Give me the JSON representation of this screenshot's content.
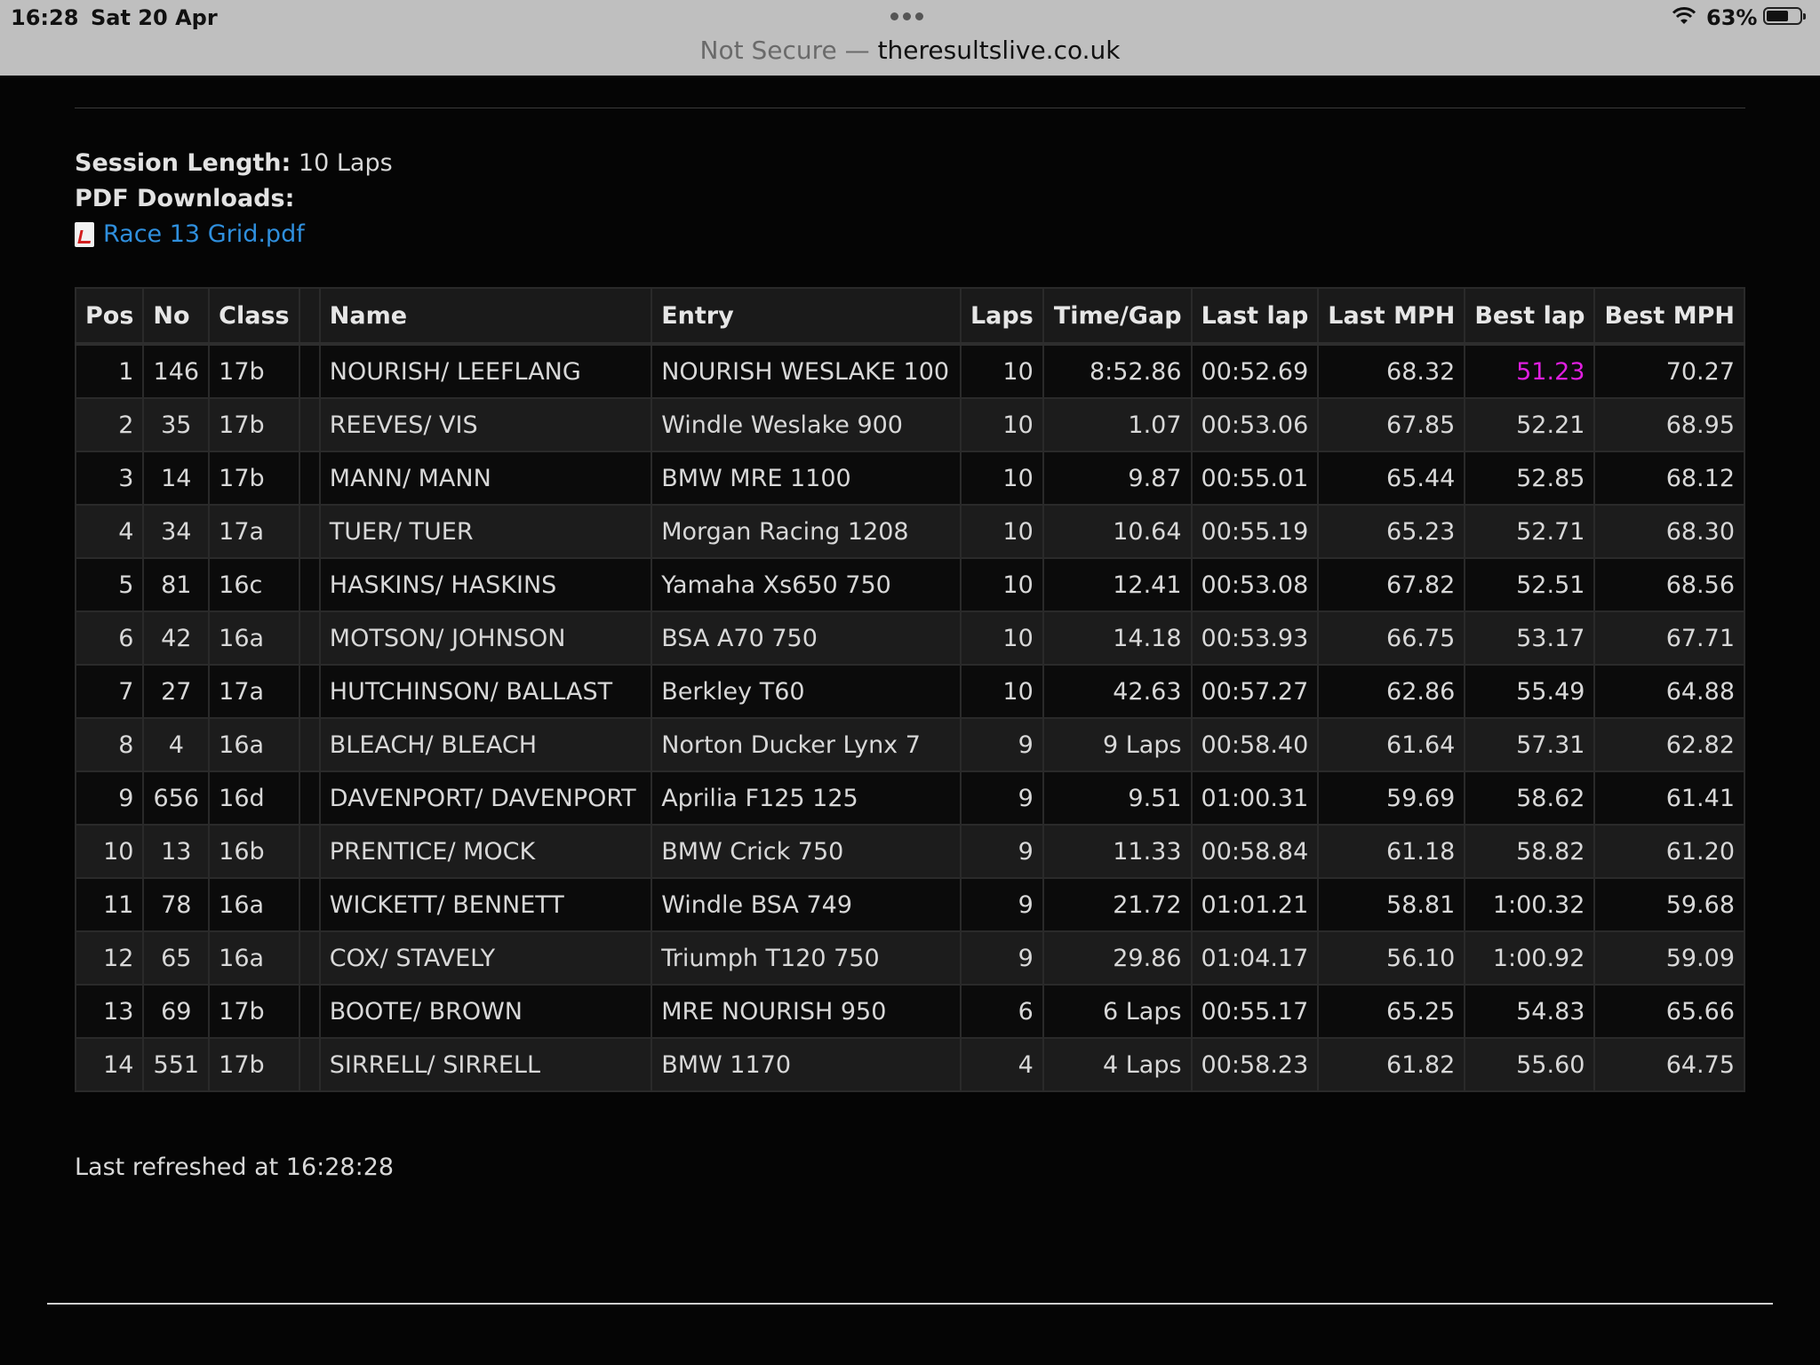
{
  "status_bar": {
    "time": "16:28",
    "date": "Sat 20 Apr",
    "battery": "63%"
  },
  "url_bar": {
    "security": "Not Secure —",
    "domain": "theresultslive.co.uk"
  },
  "session": {
    "length_label": "Session Length:",
    "length_value": "10 Laps",
    "pdf_label": "PDF Downloads:",
    "pdf_file": "Race 13 Grid.pdf"
  },
  "table": {
    "headers": [
      "Pos",
      "No",
      "Class",
      "",
      "Name",
      "Entry",
      "Laps",
      "Time/Gap",
      "Last lap",
      "Last MPH",
      "Best lap",
      "Best MPH"
    ],
    "rows": [
      [
        "1",
        "146",
        "17b",
        "NOURISH/ LEEFLANG",
        "NOURISH WESLAKE 100",
        "10",
        "8:52.86",
        "00:52.69",
        "68.32",
        "51.23",
        "70.27"
      ],
      [
        "2",
        "35",
        "17b",
        "REEVES/ VIS",
        "Windle Weslake 900",
        "10",
        "1.07",
        "00:53.06",
        "67.85",
        "52.21",
        "68.95"
      ],
      [
        "3",
        "14",
        "17b",
        "MANN/ MANN",
        "BMW MRE 1100",
        "10",
        "9.87",
        "00:55.01",
        "65.44",
        "52.85",
        "68.12"
      ],
      [
        "4",
        "34",
        "17a",
        "TUER/ TUER",
        "Morgan Racing 1208",
        "10",
        "10.64",
        "00:55.19",
        "65.23",
        "52.71",
        "68.30"
      ],
      [
        "5",
        "81",
        "16c",
        "HASKINS/ HASKINS",
        "Yamaha Xs650 750",
        "10",
        "12.41",
        "00:53.08",
        "67.82",
        "52.51",
        "68.56"
      ],
      [
        "6",
        "42",
        "16a",
        "MOTSON/ JOHNSON",
        "BSA A70 750",
        "10",
        "14.18",
        "00:53.93",
        "66.75",
        "53.17",
        "67.71"
      ],
      [
        "7",
        "27",
        "17a",
        "HUTCHINSON/ BALLAST",
        "Berkley T60",
        "10",
        "42.63",
        "00:57.27",
        "62.86",
        "55.49",
        "64.88"
      ],
      [
        "8",
        "4",
        "16a",
        "BLEACH/ BLEACH",
        "Norton Ducker Lynx 7",
        "9",
        "9 Laps",
        "00:58.40",
        "61.64",
        "57.31",
        "62.82"
      ],
      [
        "9",
        "656",
        "16d",
        "DAVENPORT/ DAVENPORT",
        "Aprilia F125 125",
        "9",
        "9.51",
        "01:00.31",
        "59.69",
        "58.62",
        "61.41"
      ],
      [
        "10",
        "13",
        "16b",
        "PRENTICE/ MOCK",
        "BMW Crick 750",
        "9",
        "11.33",
        "00:58.84",
        "61.18",
        "58.82",
        "61.20"
      ],
      [
        "11",
        "78",
        "16a",
        "WICKETT/ BENNETT",
        "Windle BSA 749",
        "9",
        "21.72",
        "01:01.21",
        "58.81",
        "1:00.32",
        "59.68"
      ],
      [
        "12",
        "65",
        "16a",
        "COX/ STAVELY",
        "Triumph T120 750",
        "9",
        "29.86",
        "01:04.17",
        "56.10",
        "1:00.92",
        "59.09"
      ],
      [
        "13",
        "69",
        "17b",
        "BOOTE/ BROWN",
        "MRE NOURISH 950",
        "6",
        "6 Laps",
        "00:55.17",
        "65.25",
        "54.83",
        "65.66"
      ],
      [
        "14",
        "551",
        "17b",
        "SIRRELL/ SIRRELL",
        "BMW 1170",
        "4",
        "4 Laps",
        "00:58.23",
        "61.82",
        "55.60",
        "64.75"
      ]
    ]
  },
  "footer": {
    "refreshed": "Last refreshed at 16:28:28"
  },
  "colors": {
    "fastest_lap": "#e01fe0",
    "link": "#2f8fdd"
  }
}
